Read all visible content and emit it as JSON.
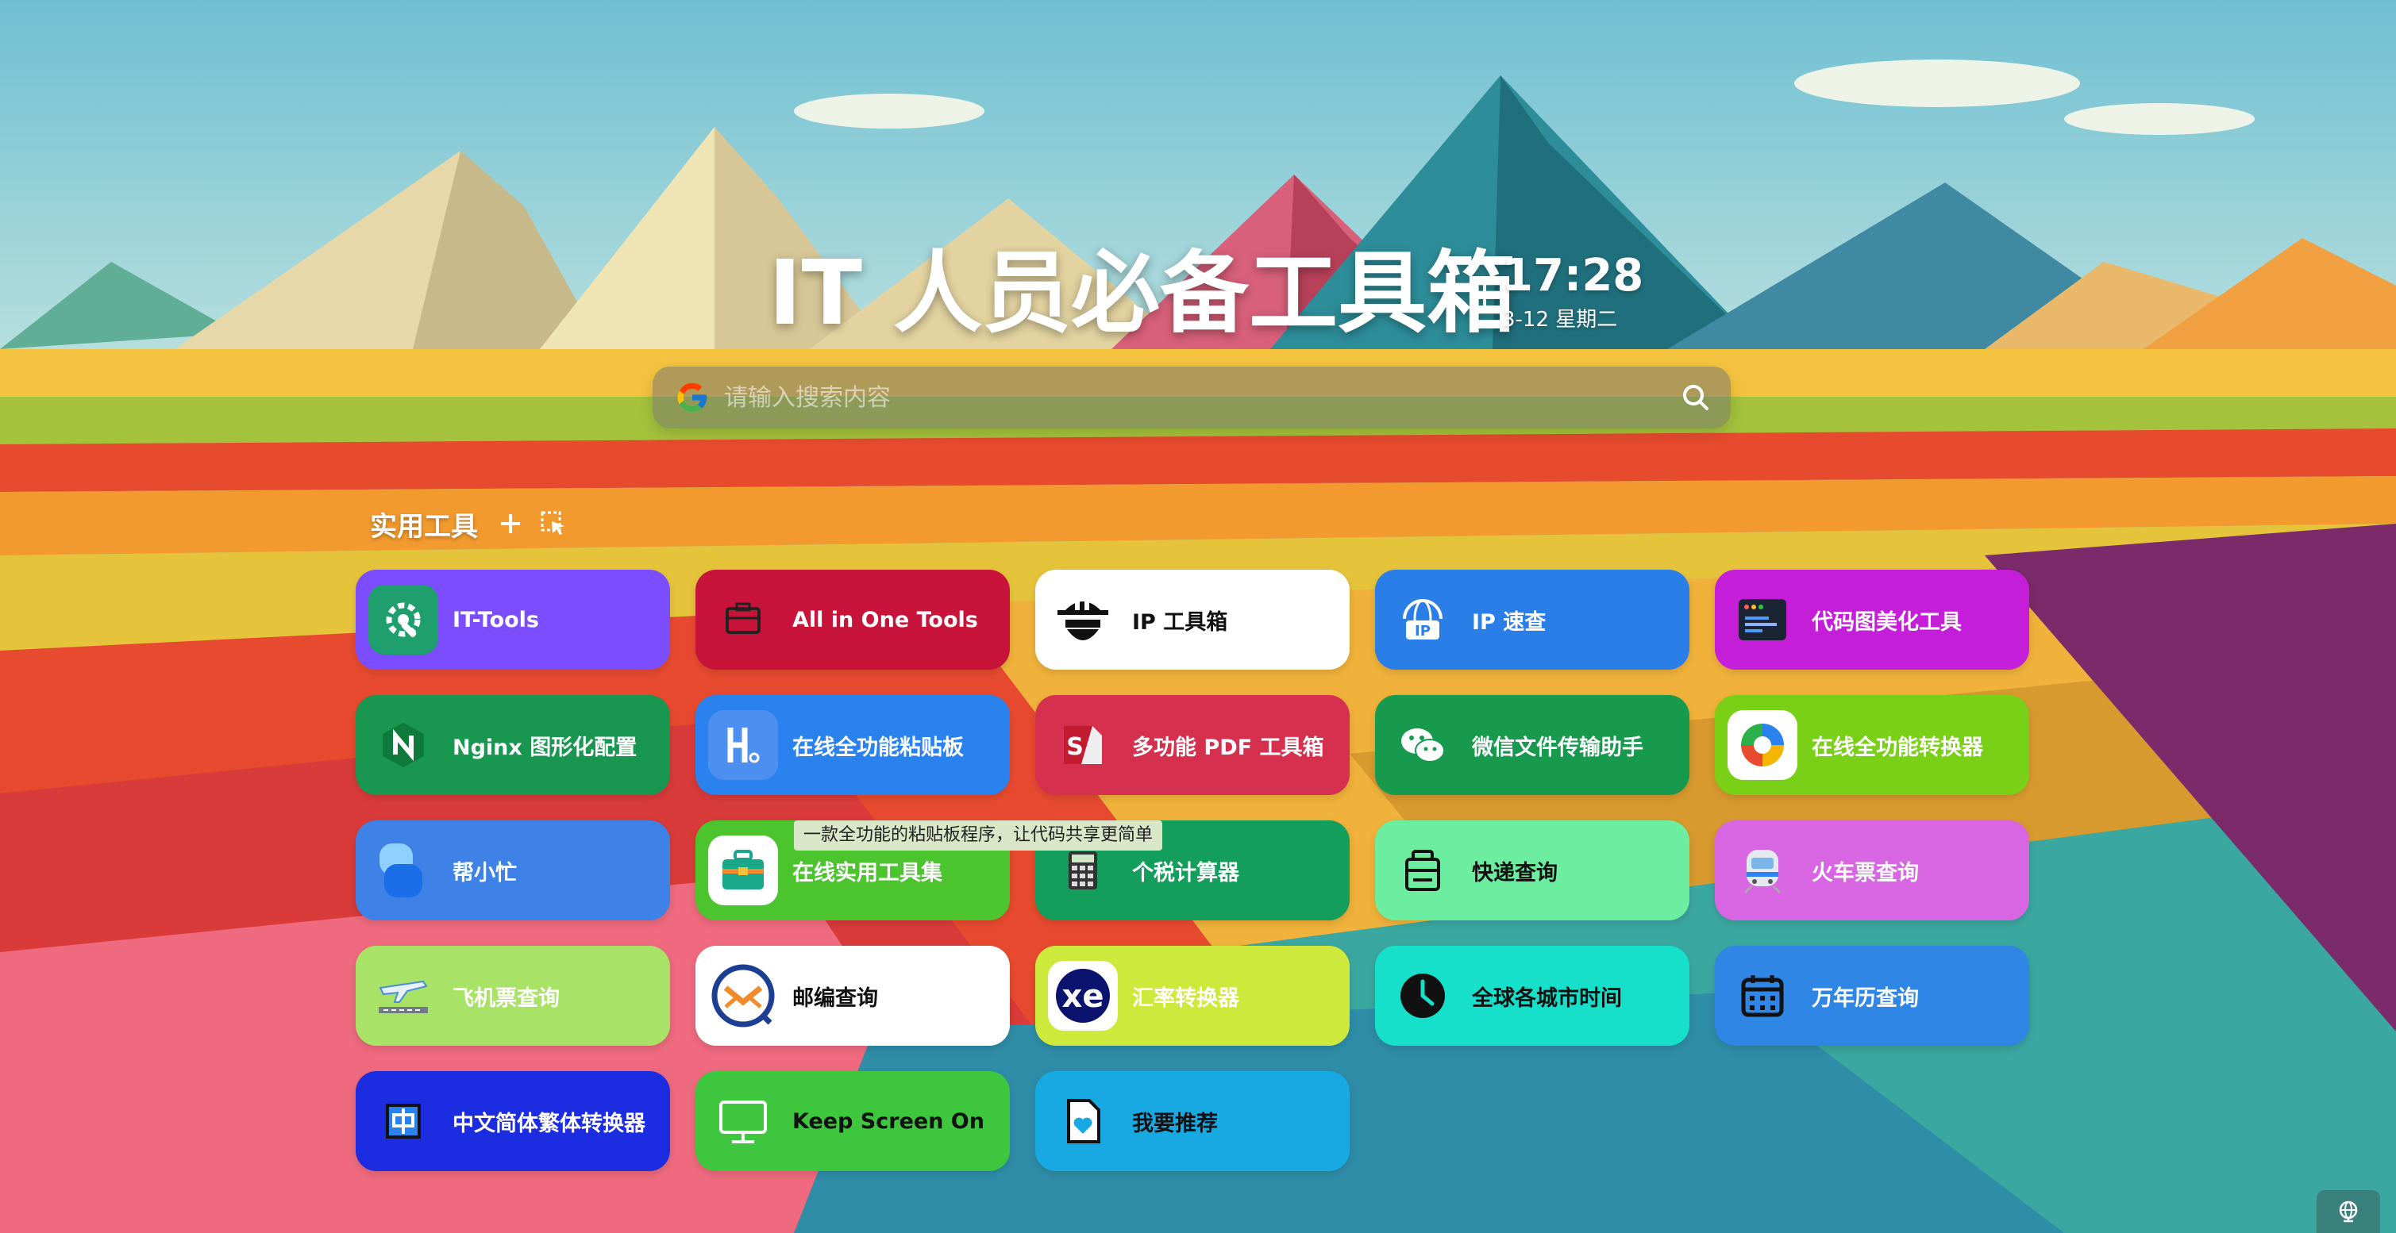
{
  "header": {
    "title": "IT 人员必备工具箱",
    "time": "17:28",
    "date": "3-12 星期二"
  },
  "search": {
    "placeholder": "请输入搜索内容"
  },
  "section": {
    "title": "实用工具"
  },
  "tools": [
    {
      "name": "IT-Tools",
      "bg": "#7b4dff",
      "icon": "gear-wrench-icon"
    },
    {
      "name": "All in One Tools",
      "bg": "#c8143a",
      "icon": "toolbox-icon"
    },
    {
      "name": "IP 工具箱",
      "bg": "#ffffff",
      "icon": "spy-icon"
    },
    {
      "name": "IP 速查",
      "bg": "#2a7ee8",
      "icon": "ip-globe-icon"
    },
    {
      "name": "代码图美化工具",
      "bg": "#c51ed8",
      "icon": "code-window-icon"
    },
    {
      "name": "Nginx 图形化配置",
      "bg": "#199650",
      "icon": "nginx-icon"
    },
    {
      "name": "在线全功能粘贴板",
      "bg": "#2a82ee",
      "icon": "clipboard-h-icon"
    },
    {
      "name": "多功能 PDF 工具箱",
      "bg": "#d5314f",
      "icon": "pdf-icon"
    },
    {
      "name": "微信文件传输助手",
      "bg": "#179a4e",
      "icon": "wechat-icon"
    },
    {
      "name": "在线全功能转换器",
      "bg": "#79d017",
      "icon": "converter-icon"
    },
    {
      "name": "帮小忙",
      "bg": "#3e82e8",
      "icon": "helper-icon"
    },
    {
      "name": "在线实用工具集",
      "bg": "#4cc42e",
      "icon": "briefcase-icon"
    },
    {
      "name": "个税计算器",
      "bg": "#149e5c",
      "icon": "calculator-icon"
    },
    {
      "name": "快递查询",
      "bg": "#6ded9f",
      "icon": "package-icon"
    },
    {
      "name": "火车票查询",
      "bg": "#d866e2",
      "icon": "train-icon"
    },
    {
      "name": "飞机票查询",
      "bg": "#a8e266",
      "icon": "airplane-icon"
    },
    {
      "name": "邮编查询",
      "bg": "#ffffff",
      "icon": "postcode-icon"
    },
    {
      "name": "汇率转换器",
      "bg": "#cde93c",
      "icon": "xe-icon"
    },
    {
      "name": "全球各城市时间",
      "bg": "#16e0c9",
      "icon": "clock-icon"
    },
    {
      "name": "万年历查询",
      "bg": "#2f86e4",
      "icon": "calendar-icon"
    },
    {
      "name": "中文简体繁体转换器",
      "bg": "#1c2ce0",
      "icon": "chinese-char-icon"
    },
    {
      "name": "Keep Screen On",
      "bg": "#3ec63e",
      "icon": "monitor-icon"
    },
    {
      "name": "我要推荐",
      "bg": "#18a8e2",
      "icon": "recommend-icon"
    }
  ],
  "tooltip": "一款全功能的粘贴板程序，让代码共享更简单"
}
